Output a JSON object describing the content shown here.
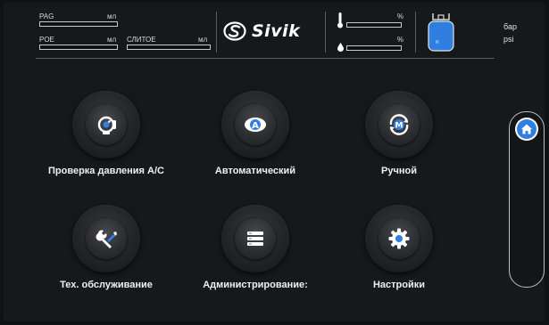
{
  "header": {
    "fluids": {
      "pag": {
        "label": "PAG",
        "unit": "мл"
      },
      "poe": {
        "label": "POE",
        "unit": "мл"
      },
      "drain": {
        "label": "СЛИТОЕ",
        "unit": "мл"
      }
    },
    "brand": "Sivik",
    "gauges": {
      "temperature": {
        "unit": "%"
      },
      "humidity": {
        "unit": "%"
      }
    },
    "tank": {
      "label": "R"
    },
    "units": {
      "pressure_bar": "бар",
      "pressure_psi": "psi"
    }
  },
  "menu": {
    "pressure_check": "Проверка давления A/C",
    "automatic": "Автоматический",
    "manual": "Ручной",
    "maintenance": "Тех. обслуживание",
    "administration": "Администрирование:",
    "settings": "Настройки"
  },
  "colors": {
    "accent": "#2f7ee0",
    "tank": "#2f7ee0",
    "text": "#f0f0f0"
  }
}
